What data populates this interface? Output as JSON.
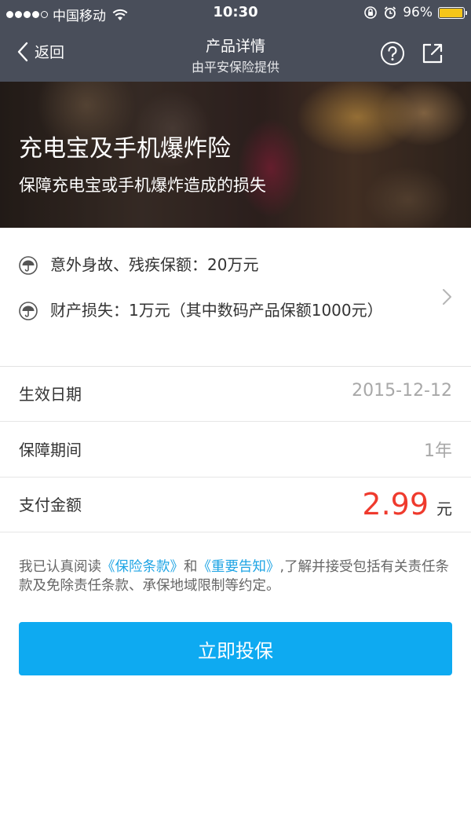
{
  "status_bar": {
    "carrier": "中国移动",
    "time": "10:30",
    "battery": "96%",
    "battery_level": 0.96,
    "battery_color": "#f5c518"
  },
  "nav": {
    "back_label": "返回",
    "title": "产品详情",
    "subtitle": "由平安保险提供",
    "icons": [
      "back-chevron-icon",
      "help-icon",
      "share-icon"
    ]
  },
  "hero": {
    "title": "充电宝及手机爆炸险",
    "subtitle": "保障充电宝或手机爆炸造成的损失"
  },
  "coverage": {
    "items": [
      {
        "icon": "umbrella-icon",
        "text": "意外身故、残疾保额：20万元"
      },
      {
        "icon": "umbrella-icon",
        "text": "财产损失：1万元（其中数码产品保额1000元）"
      }
    ]
  },
  "details": {
    "effective_date_label": "生效日期",
    "effective_date_value": "2015-12-12",
    "period_label": "保障期间",
    "period_value": "1年",
    "payment_label": "支付金额",
    "payment_value": "2.99",
    "payment_unit": "元"
  },
  "notice": {
    "prefix": "我已认真阅读",
    "link1": "《保险条款》",
    "middle": "和",
    "link2": "《重要告知》",
    "suffix": ",了解并接受包括有关责任条款及免除责任条款、承保地域限制等约定。"
  },
  "button": {
    "label": "立即投保"
  },
  "colors": {
    "header_bg": "#494e5a",
    "accent_blue": "#0eaaf1",
    "link_blue": "#1ea4e4",
    "amount_red": "#ef3a2d"
  }
}
